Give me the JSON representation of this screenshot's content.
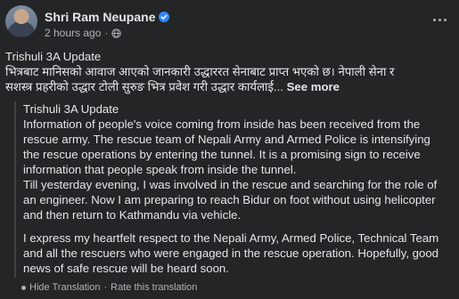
{
  "post": {
    "author_name": "Shri Ram Neupane",
    "timestamp": "2 hours ago",
    "meta_separator": "·",
    "original_text_lines": [
      "Trishuli 3A Update",
      "भित्रबाट मानिसको आवाज आएको जानकारी उद्धाररत सेनाबाट प्राप्त भएको छ। नेपाली सेना र",
      "सशस्त्र प्रहरीको उद्धार टोली सुरुङ भित्र प्रवेश गरी उद्धार कार्यलाई..."
    ],
    "see_more_label": "See more",
    "translation": {
      "title": "Trishuli 3A Update",
      "paragraph_1_lines": [
        "Information of people's voice coming from inside has been received from the",
        "rescue army. The rescue team of Nepali Army and Armed Police is intensifying",
        "the rescue operations by entering the tunnel. It is a promising sign to receive",
        "information that people speak from inside the tunnel."
      ],
      "paragraph_2_lines": [
        "Till yesterday evening, I was involved in the rescue and searching for the role of",
        "an engineer. Now I am preparing to reach Bidur on foot without using helicopter",
        "and then return to Kathmandu via vehicle."
      ],
      "paragraph_3_lines": [
        "I express my heartfelt respect to the Nepali Army, Armed Police, Technical Team",
        "and all the rescuers who were engaged in the rescue operation. Hopefully, good",
        "news of safe rescue will be heard soon."
      ],
      "hide_label": "Hide Translation",
      "rate_label": "Rate this translation",
      "footer_separator": "·"
    }
  },
  "colors": {
    "background": "#242526",
    "primary_text": "#e4e6eb",
    "secondary_text": "#b0b3b8",
    "verified_badge": "#2d88ff",
    "divider": "#3e4042"
  },
  "icons": {
    "verified": "verified-badge-icon",
    "audience": "globe-icon",
    "more": "more-options-icon",
    "translate": "translate-dot-icon"
  }
}
